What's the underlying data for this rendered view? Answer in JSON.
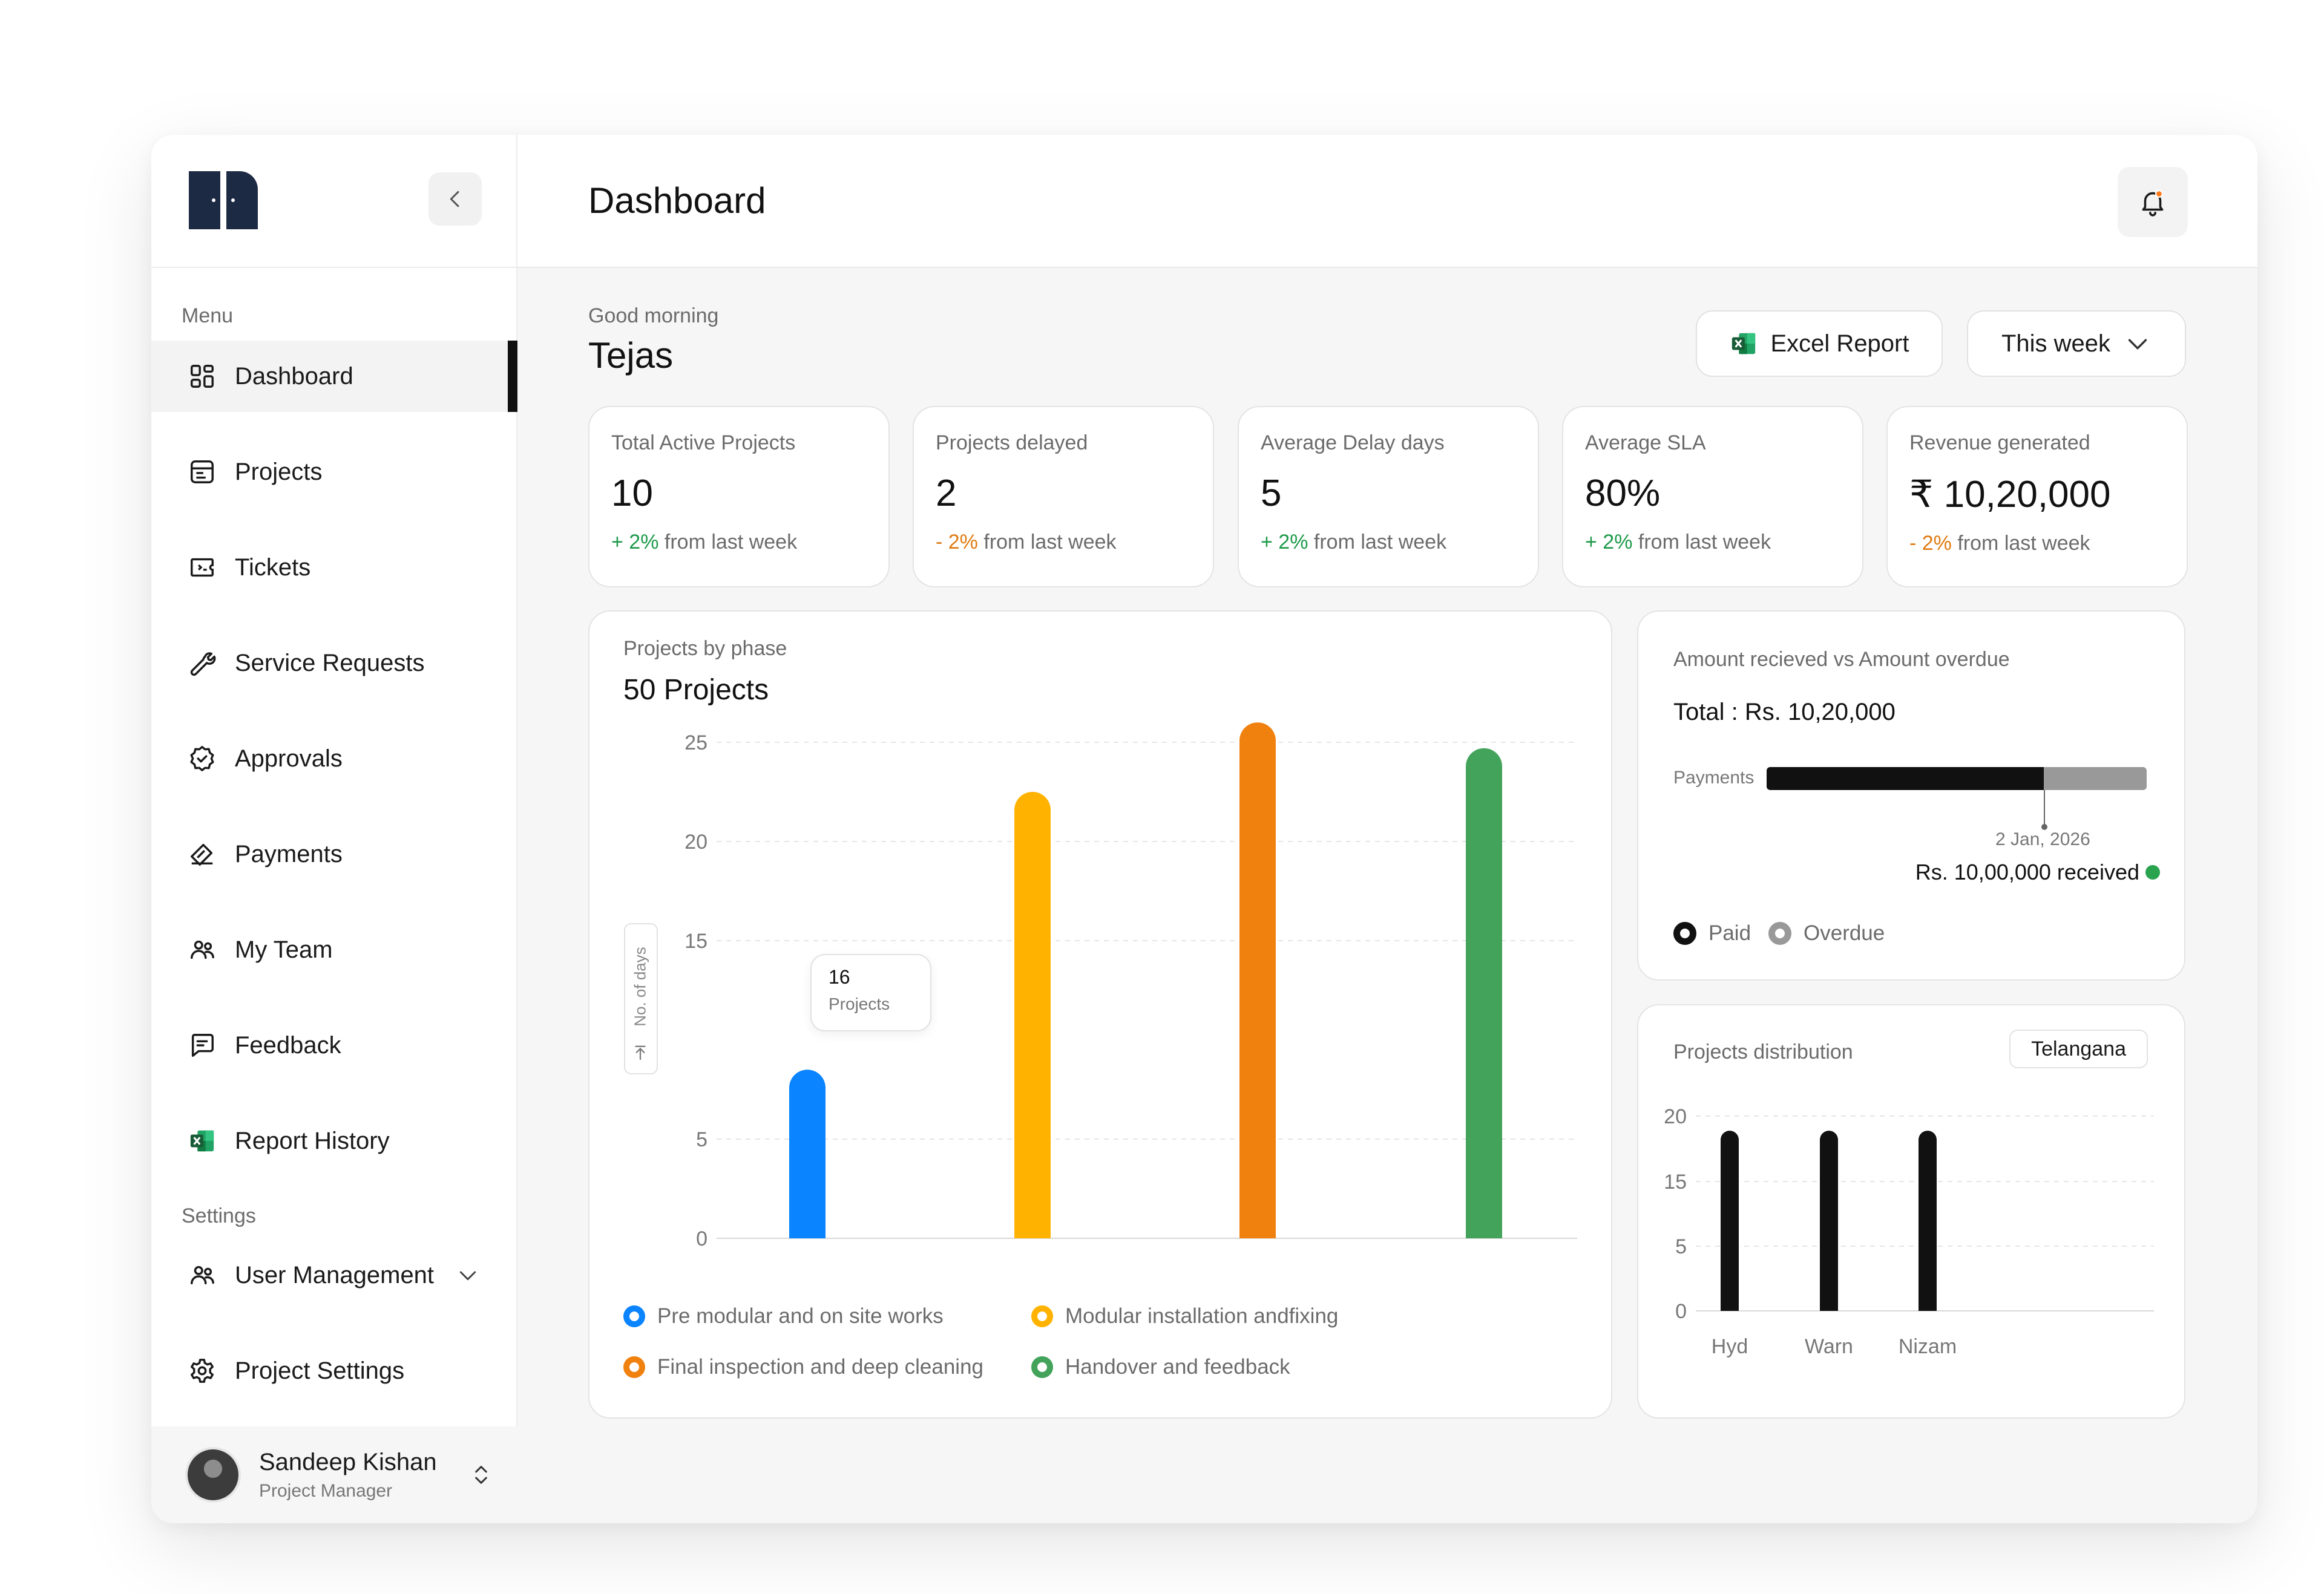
{
  "sidebar": {
    "logo": "m-logo",
    "menu_label": "Menu",
    "settings_label": "Settings",
    "items": [
      {
        "label": "Dashboard",
        "icon": "dashboard-icon",
        "active": true
      },
      {
        "label": "Projects",
        "icon": "projects-icon"
      },
      {
        "label": "Tickets",
        "icon": "tickets-icon"
      },
      {
        "label": "Service Requests",
        "icon": "wrench-icon"
      },
      {
        "label": "Approvals",
        "icon": "badge-check-icon"
      },
      {
        "label": "Payments",
        "icon": "payments-icon"
      },
      {
        "label": "My Team",
        "icon": "team-icon"
      },
      {
        "label": "Feedback",
        "icon": "feedback-icon"
      },
      {
        "label": "Report History",
        "icon": "excel-icon"
      }
    ],
    "settings_items": [
      {
        "label": "User Management",
        "icon": "users-icon"
      },
      {
        "label": "Project Settings",
        "icon": "gear-icon"
      }
    ],
    "profile": {
      "name": "Sandeep Kishan",
      "role": "Project Manager"
    }
  },
  "header": {
    "title": "Dashboard"
  },
  "welcome": {
    "greeting": "Good morning",
    "name": "Tejas"
  },
  "actions": {
    "excel": "Excel Report",
    "period": "This week"
  },
  "stats": [
    {
      "label": "Total Active Projects",
      "value": "10",
      "change": "+ 2%",
      "suffix": " from last week",
      "trend": "up"
    },
    {
      "label": "Projects delayed",
      "value": "2",
      "change": "- 2%",
      "suffix": " from last week",
      "trend": "down"
    },
    {
      "label": "Average Delay days",
      "value": "5",
      "change": "+ 2%",
      "suffix": " from last week",
      "trend": "up"
    },
    {
      "label": "Average SLA",
      "value": "80%",
      "change": "+ 2%",
      "suffix": " from last week",
      "trend": "up"
    },
    {
      "label": "Revenue generated",
      "value": "₹ 10,20,000",
      "change": "- 2%",
      "suffix": " from last week",
      "trend": "down"
    }
  ],
  "phase_panel": {
    "title": "Projects by phase",
    "total": "50 Projects",
    "ylabel": "No. of days",
    "tooltip": {
      "value": "16",
      "label": "Projects"
    }
  },
  "amount_panel": {
    "title": "Amount recieved vs Amount overdue",
    "total": "Total : Rs. 10,20,000",
    "bar_label": "Payments",
    "paid_fraction": 0.73,
    "date": "2 Jan, 2026",
    "received": "Rs. 10,00,000 received",
    "legend_paid": "Paid",
    "legend_overdue": "Overdue"
  },
  "dist_panel": {
    "title": "Projects distribution",
    "chip": "Telangana"
  },
  "chart_data": [
    {
      "type": "bar",
      "title": "Projects by phase",
      "ylabel": "No. of days",
      "yticks": [
        0,
        5,
        15,
        20,
        25
      ],
      "ylim": [
        0,
        25
      ],
      "grid": true,
      "legend_position": "bottom",
      "series": [
        {
          "name": "Pre modular and on site works",
          "value": 8.5,
          "color": "#0a84ff"
        },
        {
          "name": "Modular installation andfixing",
          "value": 22.5,
          "color": "#ffb300"
        },
        {
          "name": "Final inspection and deep cleaning",
          "value": 26,
          "color": "#f0810f"
        },
        {
          "name": "Handover and feedback",
          "value": 24.7,
          "color": "#43a35a"
        }
      ]
    },
    {
      "type": "bar",
      "title": "Projects distribution",
      "categories": [
        "Hyd",
        "Warn",
        "Nizam"
      ],
      "values": [
        18.5,
        18.5,
        18.5
      ],
      "yticks": [
        0,
        5,
        15,
        20
      ],
      "ylim": [
        0,
        20
      ],
      "grid": true,
      "color": "#111111"
    }
  ]
}
